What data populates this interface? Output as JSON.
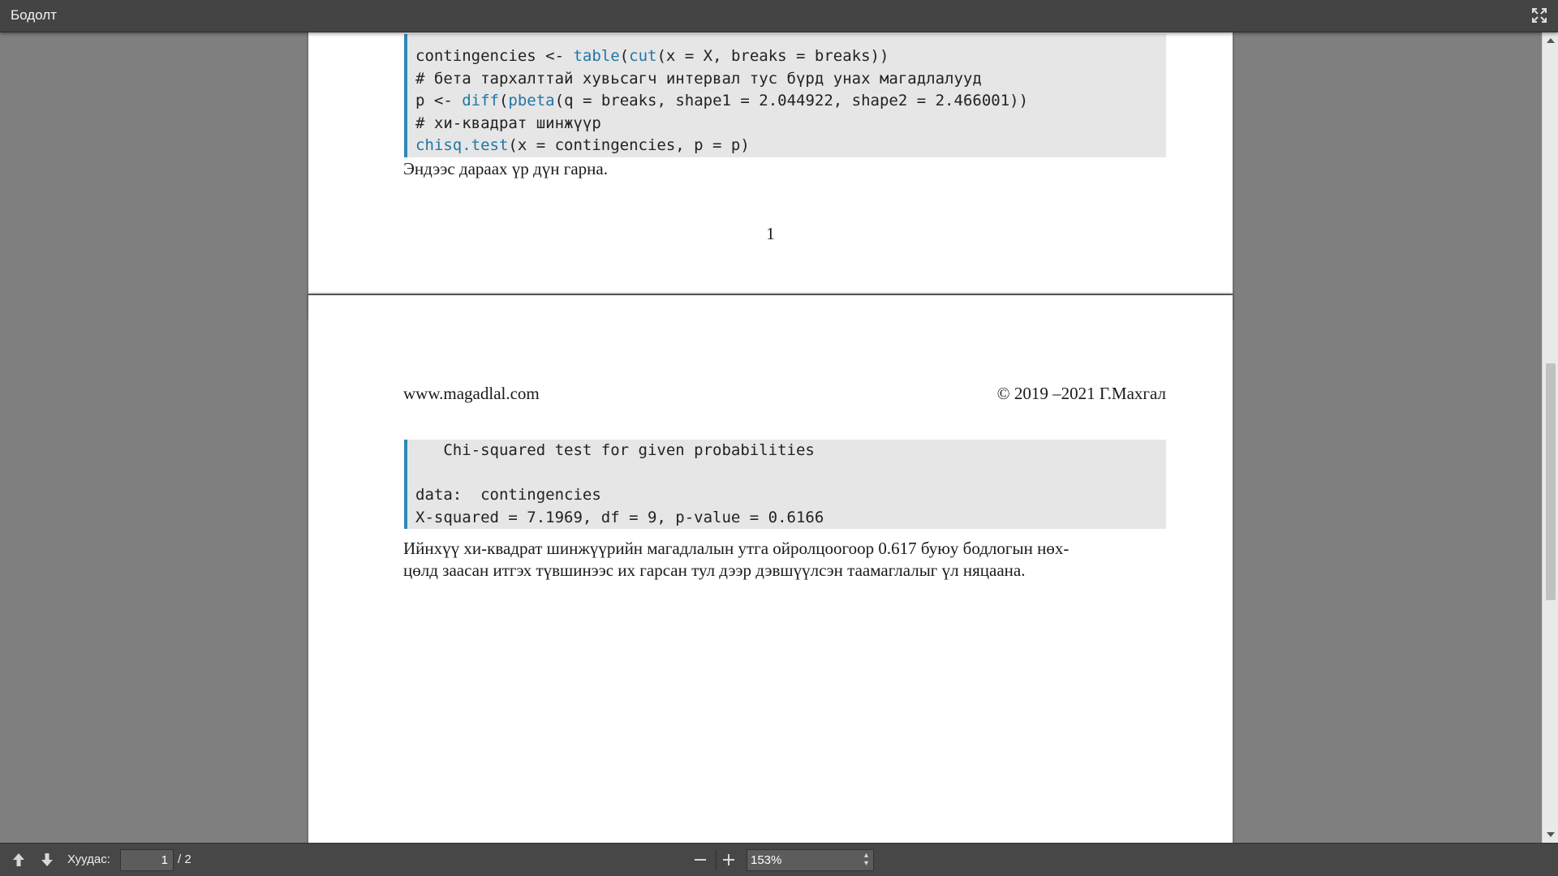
{
  "window": {
    "title": "Бодолт"
  },
  "document": {
    "page1": {
      "code_lines": [
        {
          "segments": [
            {
              "text": "contingencies <- ",
              "kw": false
            },
            {
              "text": "table",
              "kw": true
            },
            {
              "text": "(",
              "kw": false
            },
            {
              "text": "cut",
              "kw": true
            },
            {
              "text": "(x = X, breaks = breaks))",
              "kw": false
            }
          ]
        },
        {
          "segments": [
            {
              "text": "# бета тархалттай хувьсагч интервал тус бүрд унах магадлалууд",
              "kw": false
            }
          ]
        },
        {
          "segments": [
            {
              "text": "p <- ",
              "kw": false
            },
            {
              "text": "diff",
              "kw": true
            },
            {
              "text": "(",
              "kw": false
            },
            {
              "text": "pbeta",
              "kw": true
            },
            {
              "text": "(q = breaks, shape1 = 2.044922, shape2 = 2.466001))",
              "kw": false
            }
          ]
        },
        {
          "segments": [
            {
              "text": "# хи-квадрат шинжүүр",
              "kw": false
            }
          ]
        },
        {
          "segments": [
            {
              "text": "chisq.test",
              "kw": true
            },
            {
              "text": "(x = contingencies, p = p)",
              "kw": false
            }
          ]
        }
      ],
      "paragraph": "Эндээс дараах үр дүн гарна.",
      "page_number": "1"
    },
    "page2": {
      "header_left": "www.magadlal.com",
      "header_right": "© 2019 –2021 Г.Махгал",
      "output_lines": [
        "   Chi-squared test for given probabilities",
        "",
        "data:  contingencies",
        "X-squared = 7.1969, df = 9, p-value = 0.6166"
      ],
      "paragraph_line1": "Ийнхүү хи-квадрат шинжүүрийн магадлалын утга ойролцоогоор 0.617 буюу бодлогын нөх-",
      "paragraph_line2": "цөлд заасан итгэх түвшинээс их гарсан тул дээр дэвшүүлсэн таамаглалыг үл няцаана."
    }
  },
  "toolbar": {
    "page_label": "Хуудас:",
    "current_page": "1",
    "page_total": "/ 2",
    "zoom": "153%"
  },
  "icons": {
    "fullscreen": "fullscreen-icon",
    "prev": "arrow-up-icon",
    "next": "arrow-down-icon",
    "zoom_out": "minus-icon",
    "zoom_in": "plus-icon"
  }
}
